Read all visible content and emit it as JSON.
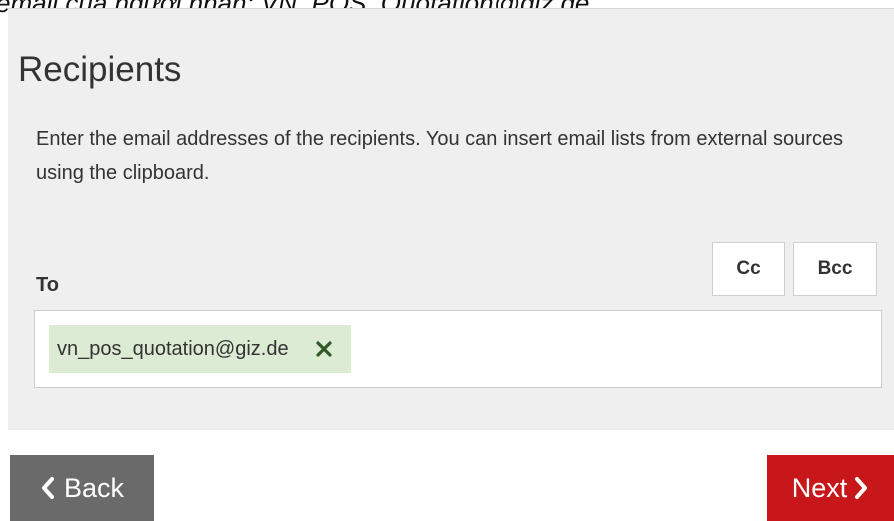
{
  "document": {
    "caption": "email của người nhận: VN_POS_Quotation@giz.de"
  },
  "recipients": {
    "title": "Recipients",
    "description": "Enter the email addresses of the recipients. You can insert email lists from external sources using the clipboard.",
    "to_label": "To",
    "cc_label": "Cc",
    "bcc_label": "Bcc",
    "chips": [
      {
        "email": "vn_pos_quotation@giz.de",
        "remove_icon": "close-icon"
      }
    ]
  },
  "navigation": {
    "back_label": "Back",
    "back_icon": "chevron-left-icon",
    "next_label": "Next",
    "next_icon": "chevron-right-icon"
  },
  "colors": {
    "panel_background": "#efefef",
    "chip_background": "#dcebd4",
    "chip_remove_icon": "#2e5a24",
    "back_button": "#6a6a6a",
    "next_button": "#c8171b"
  }
}
